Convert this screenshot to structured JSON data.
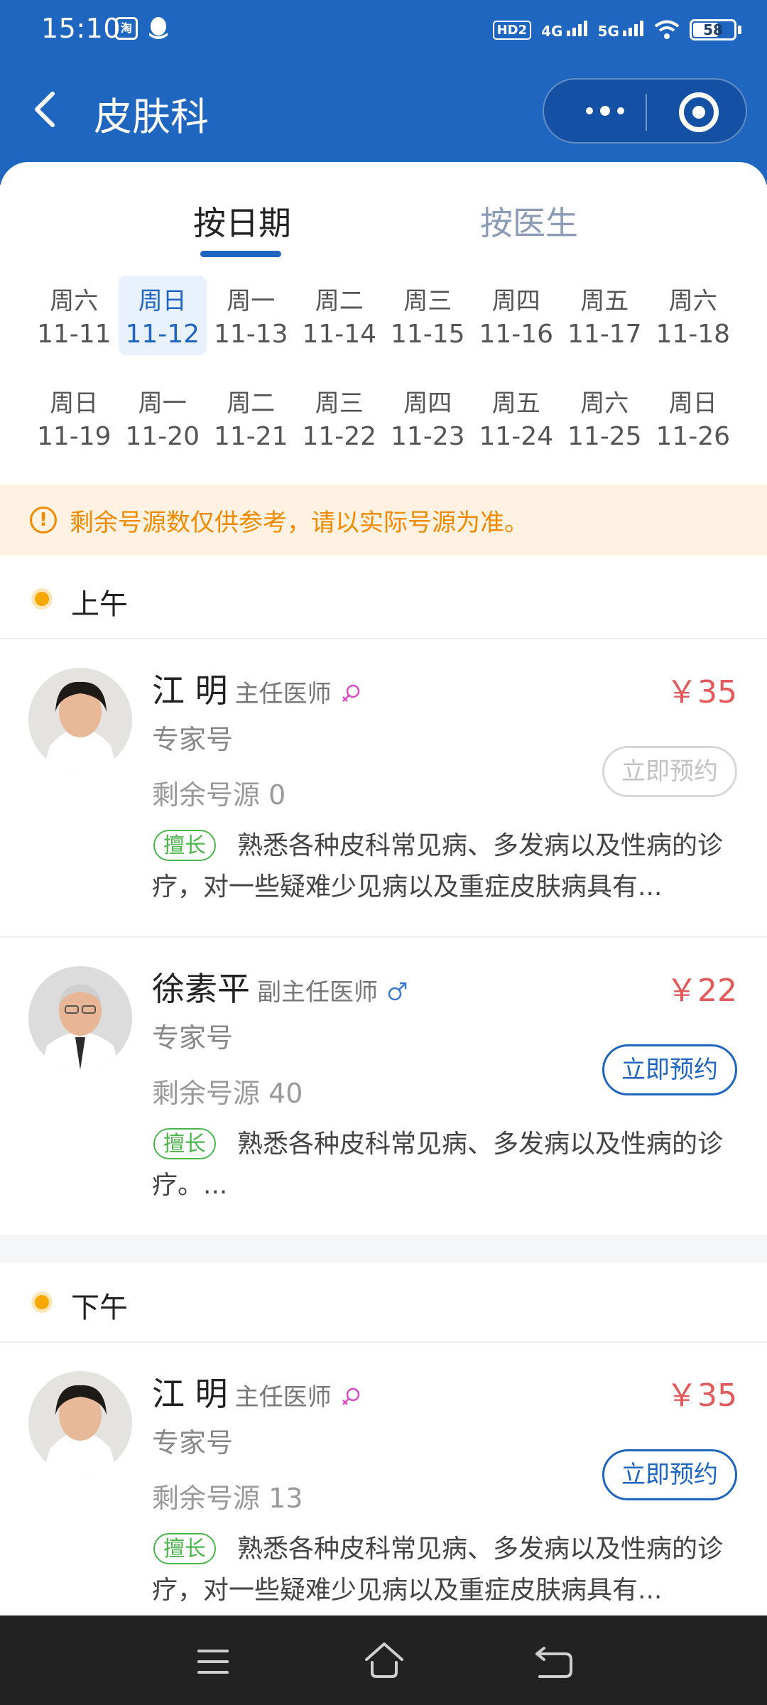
{
  "status_bar": {
    "time": "15:10",
    "app_badge": "淘",
    "hd_badge": "HD2",
    "signal_4g": "4G",
    "signal_5g": "5G",
    "battery": "58"
  },
  "nav": {
    "title": "皮肤科"
  },
  "tabs": {
    "by_date": "按日期",
    "by_doctor": "按医生"
  },
  "dates": [
    [
      {
        "weekday": "周六",
        "date": "11-11"
      },
      {
        "weekday": "周日",
        "date": "11-12"
      },
      {
        "weekday": "周一",
        "date": "11-13"
      },
      {
        "weekday": "周二",
        "date": "11-14"
      },
      {
        "weekday": "周三",
        "date": "11-15"
      },
      {
        "weekday": "周四",
        "date": "11-16"
      },
      {
        "weekday": "周五",
        "date": "11-17"
      },
      {
        "weekday": "周六",
        "date": "11-18"
      }
    ],
    [
      {
        "weekday": "周日",
        "date": "11-19"
      },
      {
        "weekday": "周一",
        "date": "11-20"
      },
      {
        "weekday": "周二",
        "date": "11-21"
      },
      {
        "weekday": "周三",
        "date": "11-22"
      },
      {
        "weekday": "周四",
        "date": "11-23"
      },
      {
        "weekday": "周五",
        "date": "11-24"
      },
      {
        "weekday": "周六",
        "date": "11-25"
      },
      {
        "weekday": "周日",
        "date": "11-26"
      }
    ]
  ],
  "selected_date": "11-12",
  "notice": {
    "icon": "!",
    "text": "剩余号源数仅供参考，请以实际号源为准。"
  },
  "periods": {
    "morning": "上午",
    "afternoon": "下午"
  },
  "doctors": [
    {
      "name": "江 明",
      "title": "主任医师",
      "gender_icon": "female-icon",
      "type": "专家号",
      "remaining": "剩余号源 0",
      "price": "￥35",
      "button": "立即预约",
      "button_enabled": false,
      "specialty_tag": "擅长",
      "specialty": "熟悉各种皮科常见病、多发病以及性病的诊疗，对一些疑难少见病以及重症皮肤病具有..."
    },
    {
      "name": "徐素平",
      "title": "副主任医师",
      "gender_icon": "male-icon",
      "type": "专家号",
      "remaining": "剩余号源 40",
      "price": "￥22",
      "button": "立即预约",
      "button_enabled": true,
      "specialty_tag": "擅长",
      "specialty": "熟悉各种皮科常见病、多发病以及性病的诊疗。..."
    },
    {
      "name": "江 明",
      "title": "主任医师",
      "gender_icon": "female-icon",
      "type": "专家号",
      "remaining": "剩余号源 13",
      "price": "￥35",
      "button": "立即预约",
      "button_enabled": true,
      "specialty_tag": "擅长",
      "specialty": "熟悉各种皮科常见病、多发病以及性病的诊疗，对一些疑难少见病以及重症皮肤病具有..."
    }
  ],
  "colors": {
    "primary": "#1f66c1",
    "price": "#e45a5a",
    "notice": "#f08a00",
    "specialty_tag": "#4cb64c"
  }
}
